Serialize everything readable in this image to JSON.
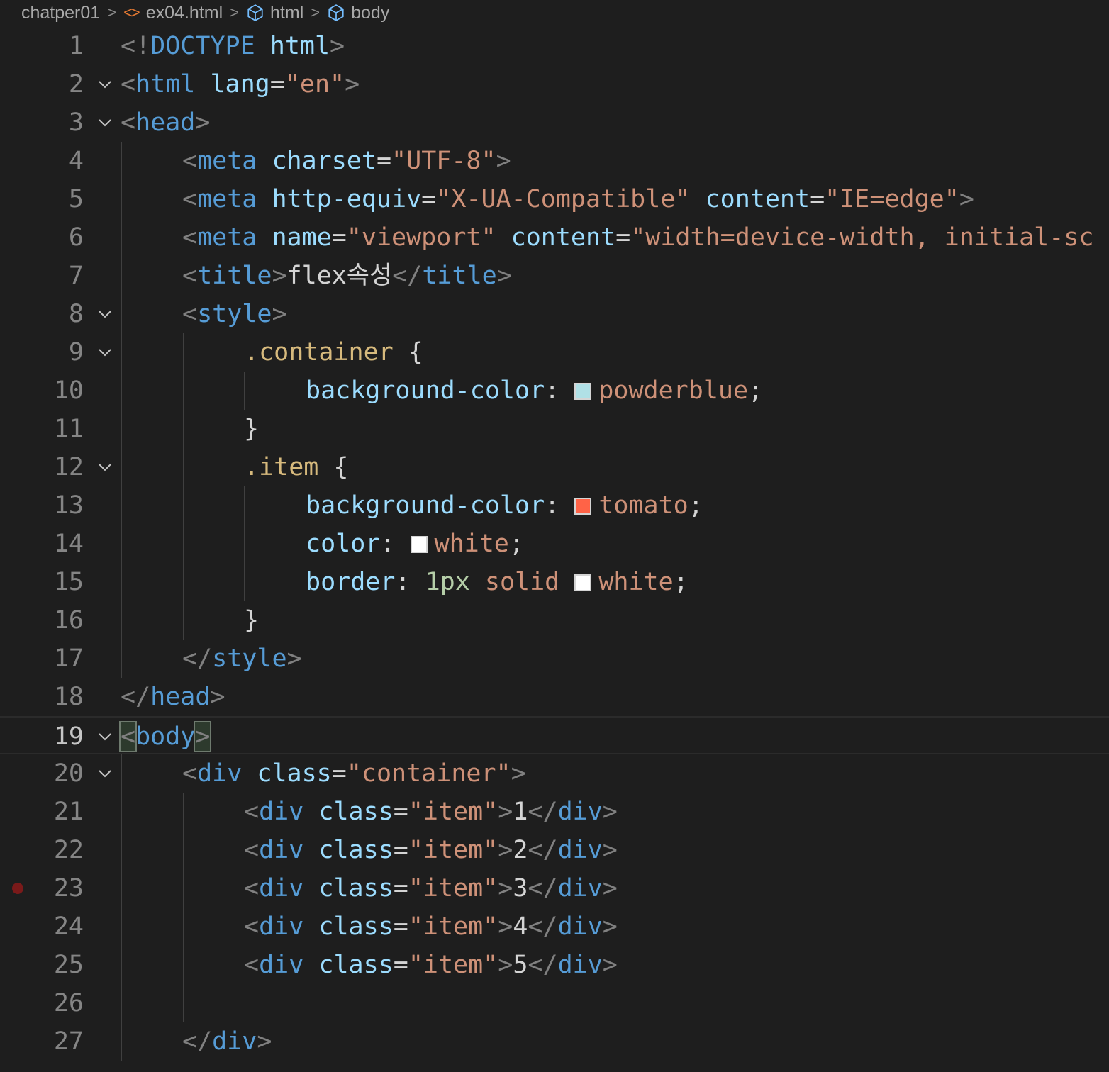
{
  "breadcrumb": {
    "folder": "chatper01",
    "file": "ex04.html",
    "node1": "html",
    "node2": "body",
    "separator": ">"
  },
  "editor": {
    "active_line": 19,
    "breakpoint_line": 23,
    "folded_lines": [
      2,
      3,
      8,
      9,
      12,
      19,
      20
    ],
    "swatches": {
      "powderblue": "#b0e0e6",
      "tomato": "#ff6347",
      "white": "#ffffff"
    },
    "lines": [
      {
        "n": "1",
        "indent": 0,
        "tokens": [
          [
            "punc",
            "<!"
          ],
          [
            "tag",
            "DOCTYPE"
          ],
          [
            "text",
            " "
          ],
          [
            "attr",
            "html"
          ],
          [
            "punc",
            ">"
          ]
        ]
      },
      {
        "n": "2",
        "indent": 0,
        "tokens": [
          [
            "punc",
            "<"
          ],
          [
            "tag",
            "html"
          ],
          [
            "text",
            " "
          ],
          [
            "attr",
            "lang"
          ],
          [
            "text",
            "="
          ],
          [
            "str",
            "\"en\""
          ],
          [
            "punc",
            ">"
          ]
        ]
      },
      {
        "n": "3",
        "indent": 0,
        "tokens": [
          [
            "punc",
            "<"
          ],
          [
            "tag",
            "head"
          ],
          [
            "punc",
            ">"
          ]
        ]
      },
      {
        "n": "4",
        "indent": 1,
        "tokens": [
          [
            "punc",
            "<"
          ],
          [
            "tag",
            "meta"
          ],
          [
            "text",
            " "
          ],
          [
            "attr",
            "charset"
          ],
          [
            "text",
            "="
          ],
          [
            "str",
            "\"UTF-8\""
          ],
          [
            "punc",
            ">"
          ]
        ]
      },
      {
        "n": "5",
        "indent": 1,
        "tokens": [
          [
            "punc",
            "<"
          ],
          [
            "tag",
            "meta"
          ],
          [
            "text",
            " "
          ],
          [
            "attr",
            "http-equiv"
          ],
          [
            "text",
            "="
          ],
          [
            "str",
            "\"X-UA-Compatible\""
          ],
          [
            "text",
            " "
          ],
          [
            "attr",
            "content"
          ],
          [
            "text",
            "="
          ],
          [
            "str",
            "\"IE=edge\""
          ],
          [
            "punc",
            ">"
          ]
        ]
      },
      {
        "n": "6",
        "indent": 1,
        "tokens": [
          [
            "punc",
            "<"
          ],
          [
            "tag",
            "meta"
          ],
          [
            "text",
            " "
          ],
          [
            "attr",
            "name"
          ],
          [
            "text",
            "="
          ],
          [
            "str",
            "\"viewport\""
          ],
          [
            "text",
            " "
          ],
          [
            "attr",
            "content"
          ],
          [
            "text",
            "="
          ],
          [
            "str",
            "\"width=device-width, initial-sc"
          ]
        ]
      },
      {
        "n": "7",
        "indent": 1,
        "tokens": [
          [
            "punc",
            "<"
          ],
          [
            "tag",
            "title"
          ],
          [
            "punc",
            ">"
          ],
          [
            "text",
            "flex속성"
          ],
          [
            "punc",
            "</"
          ],
          [
            "tag",
            "title"
          ],
          [
            "punc",
            ">"
          ]
        ]
      },
      {
        "n": "8",
        "indent": 1,
        "tokens": [
          [
            "punc",
            "<"
          ],
          [
            "tag",
            "style"
          ],
          [
            "punc",
            ">"
          ]
        ]
      },
      {
        "n": "9",
        "indent": 2,
        "tokens": [
          [
            "sel",
            ".container"
          ],
          [
            "text",
            " {"
          ]
        ]
      },
      {
        "n": "10",
        "indent": 3,
        "tokens": [
          [
            "attr",
            "background-color"
          ],
          [
            "text",
            ": "
          ],
          [
            "swatch",
            "powderblue"
          ],
          [
            "str",
            "powderblue"
          ],
          [
            "text",
            ";"
          ]
        ]
      },
      {
        "n": "11",
        "indent": 2,
        "tokens": [
          [
            "text",
            "}"
          ]
        ]
      },
      {
        "n": "12",
        "indent": 2,
        "tokens": [
          [
            "sel",
            ".item"
          ],
          [
            "text",
            " {"
          ]
        ]
      },
      {
        "n": "13",
        "indent": 3,
        "tokens": [
          [
            "attr",
            "background-color"
          ],
          [
            "text",
            ": "
          ],
          [
            "swatch",
            "tomato"
          ],
          [
            "str",
            "tomato"
          ],
          [
            "text",
            ";"
          ]
        ]
      },
      {
        "n": "14",
        "indent": 3,
        "tokens": [
          [
            "attr",
            "color"
          ],
          [
            "text",
            ": "
          ],
          [
            "swatch",
            "white"
          ],
          [
            "str",
            "white"
          ],
          [
            "text",
            ";"
          ]
        ]
      },
      {
        "n": "15",
        "indent": 3,
        "tokens": [
          [
            "attr",
            "border"
          ],
          [
            "text",
            ": "
          ],
          [
            "num",
            "1px"
          ],
          [
            "text",
            " "
          ],
          [
            "str",
            "solid"
          ],
          [
            "text",
            " "
          ],
          [
            "swatch",
            "white"
          ],
          [
            "str",
            "white"
          ],
          [
            "text",
            ";"
          ]
        ]
      },
      {
        "n": "16",
        "indent": 2,
        "tokens": [
          [
            "text",
            "}"
          ]
        ]
      },
      {
        "n": "17",
        "indent": 1,
        "tokens": [
          [
            "punc",
            "</"
          ],
          [
            "tag",
            "style"
          ],
          [
            "punc",
            ">"
          ]
        ]
      },
      {
        "n": "18",
        "indent": 0,
        "tokens": [
          [
            "punc",
            "</"
          ],
          [
            "tag",
            "head"
          ],
          [
            "punc",
            ">"
          ]
        ]
      },
      {
        "n": "19",
        "indent": 0,
        "tokens": [
          [
            "hlpunc",
            "<"
          ],
          [
            "tag",
            "body"
          ],
          [
            "hlpunc",
            ">"
          ]
        ]
      },
      {
        "n": "20",
        "indent": 1,
        "tokens": [
          [
            "punc",
            "<"
          ],
          [
            "tag",
            "div"
          ],
          [
            "text",
            " "
          ],
          [
            "attr",
            "class"
          ],
          [
            "text",
            "="
          ],
          [
            "str",
            "\"container\""
          ],
          [
            "punc",
            ">"
          ]
        ]
      },
      {
        "n": "21",
        "indent": 2,
        "tokens": [
          [
            "punc",
            "<"
          ],
          [
            "tag",
            "div"
          ],
          [
            "text",
            " "
          ],
          [
            "attr",
            "class"
          ],
          [
            "text",
            "="
          ],
          [
            "str",
            "\"item\""
          ],
          [
            "punc",
            ">"
          ],
          [
            "text",
            "1"
          ],
          [
            "punc",
            "</"
          ],
          [
            "tag",
            "div"
          ],
          [
            "punc",
            ">"
          ]
        ]
      },
      {
        "n": "22",
        "indent": 2,
        "tokens": [
          [
            "punc",
            "<"
          ],
          [
            "tag",
            "div"
          ],
          [
            "text",
            " "
          ],
          [
            "attr",
            "class"
          ],
          [
            "text",
            "="
          ],
          [
            "str",
            "\"item\""
          ],
          [
            "punc",
            ">"
          ],
          [
            "text",
            "2"
          ],
          [
            "punc",
            "</"
          ],
          [
            "tag",
            "div"
          ],
          [
            "punc",
            ">"
          ]
        ]
      },
      {
        "n": "23",
        "indent": 2,
        "tokens": [
          [
            "punc",
            "<"
          ],
          [
            "tag",
            "div"
          ],
          [
            "text",
            " "
          ],
          [
            "attr",
            "class"
          ],
          [
            "text",
            "="
          ],
          [
            "str",
            "\"item\""
          ],
          [
            "punc",
            ">"
          ],
          [
            "text",
            "3"
          ],
          [
            "punc",
            "</"
          ],
          [
            "tag",
            "div"
          ],
          [
            "punc",
            ">"
          ]
        ]
      },
      {
        "n": "24",
        "indent": 2,
        "tokens": [
          [
            "punc",
            "<"
          ],
          [
            "tag",
            "div"
          ],
          [
            "text",
            " "
          ],
          [
            "attr",
            "class"
          ],
          [
            "text",
            "="
          ],
          [
            "str",
            "\"item\""
          ],
          [
            "punc",
            ">"
          ],
          [
            "text",
            "4"
          ],
          [
            "punc",
            "</"
          ],
          [
            "tag",
            "div"
          ],
          [
            "punc",
            ">"
          ]
        ]
      },
      {
        "n": "25",
        "indent": 2,
        "tokens": [
          [
            "punc",
            "<"
          ],
          [
            "tag",
            "div"
          ],
          [
            "text",
            " "
          ],
          [
            "attr",
            "class"
          ],
          [
            "text",
            "="
          ],
          [
            "str",
            "\"item\""
          ],
          [
            "punc",
            ">"
          ],
          [
            "text",
            "5"
          ],
          [
            "punc",
            "</"
          ],
          [
            "tag",
            "div"
          ],
          [
            "punc",
            ">"
          ]
        ]
      },
      {
        "n": "26",
        "indent": 0,
        "tokens": []
      },
      {
        "n": "27",
        "indent": 1,
        "tokens": [
          [
            "punc",
            "</"
          ],
          [
            "tag",
            "div"
          ],
          [
            "punc",
            ">"
          ]
        ]
      }
    ]
  }
}
